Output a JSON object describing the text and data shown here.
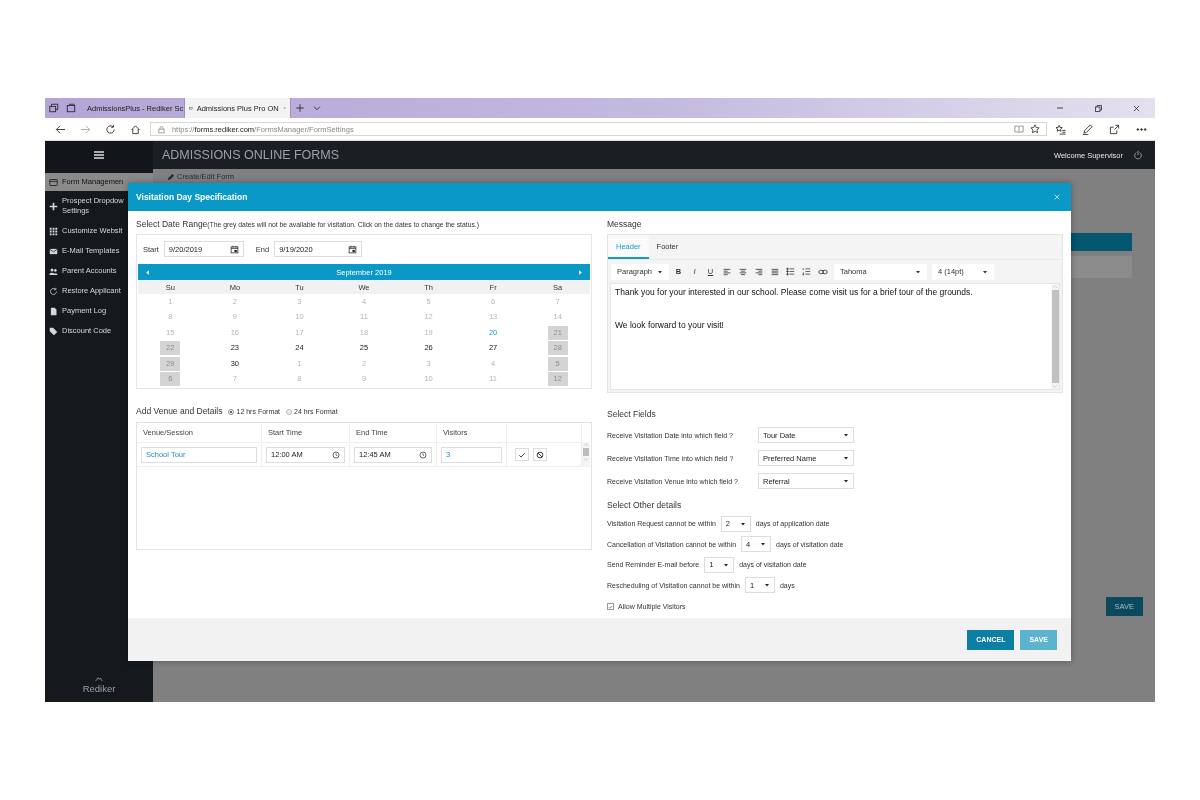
{
  "browser": {
    "tabs": [
      {
        "title": "AdmissionsPlus - Rediker Sc",
        "selected": false
      },
      {
        "title": "Admissions Plus Pro ON",
        "selected": true
      }
    ],
    "address": {
      "scheme": "https://",
      "host": "forms.rediker.com",
      "path": "/FormsManager/FormSettings"
    }
  },
  "app": {
    "title": "ADMISSIONS ONLINE FORMS",
    "welcome": "Welcome Supervisor",
    "sidebar": [
      {
        "label": "Form Managemen",
        "selected": true
      },
      {
        "label": "Prospect Dropdow Settings",
        "selected": false
      },
      {
        "label": "Customize Websit",
        "selected": false
      },
      {
        "label": "E-Mail Templates",
        "selected": false
      },
      {
        "label": "Parent Accounts",
        "selected": false
      },
      {
        "label": "Restore Applicant",
        "selected": false
      },
      {
        "label": "Payment Log",
        "selected": false
      },
      {
        "label": "Discount Code",
        "selected": false
      }
    ],
    "logo": "Rediker",
    "breadcrumb": "Create/Edit Form",
    "save_button": "SAVE"
  },
  "modal": {
    "title": "Visitation Day Specification",
    "date_range": {
      "heading": "Select Date Range",
      "note": "(The grey dates will not be available for visitation. Click on the dates to change the status.)",
      "start_label": "Start",
      "start": "9/20/2019",
      "end_label": "End",
      "end": "9/19/2020"
    },
    "calendar": {
      "month": "September 2019",
      "weekdays": [
        "Su",
        "Mo",
        "Tu",
        "We",
        "Th",
        "Fr",
        "Sa"
      ],
      "weeks": [
        [
          {
            "day": "1",
            "disabled": true,
            "blocked": false,
            "selected": false
          },
          {
            "day": "2",
            "disabled": true,
            "blocked": false,
            "selected": false
          },
          {
            "day": "3",
            "disabled": true,
            "blocked": false,
            "selected": false
          },
          {
            "day": "4",
            "disabled": true,
            "blocked": false,
            "selected": false
          },
          {
            "day": "5",
            "disabled": true,
            "blocked": false,
            "selected": false
          },
          {
            "day": "6",
            "disabled": true,
            "blocked": false,
            "selected": false
          },
          {
            "day": "7",
            "disabled": true,
            "blocked": false,
            "selected": false
          }
        ],
        [
          {
            "day": "8",
            "disabled": true,
            "blocked": false,
            "selected": false
          },
          {
            "day": "9",
            "disabled": true,
            "blocked": false,
            "selected": false
          },
          {
            "day": "10",
            "disabled": true,
            "blocked": false,
            "selected": false
          },
          {
            "day": "11",
            "disabled": true,
            "blocked": false,
            "selected": false
          },
          {
            "day": "12",
            "disabled": true,
            "blocked": false,
            "selected": false
          },
          {
            "day": "13",
            "disabled": true,
            "blocked": false,
            "selected": false
          },
          {
            "day": "14",
            "disabled": true,
            "blocked": false,
            "selected": false
          }
        ],
        [
          {
            "day": "15",
            "disabled": true,
            "blocked": false,
            "selected": false
          },
          {
            "day": "16",
            "disabled": true,
            "blocked": false,
            "selected": false
          },
          {
            "day": "17",
            "disabled": true,
            "blocked": false,
            "selected": false
          },
          {
            "day": "18",
            "disabled": true,
            "blocked": false,
            "selected": false
          },
          {
            "day": "19",
            "disabled": true,
            "blocked": false,
            "selected": false
          },
          {
            "day": "20",
            "disabled": false,
            "blocked": false,
            "selected": true
          },
          {
            "day": "21",
            "disabled": false,
            "blocked": true,
            "selected": false
          }
        ],
        [
          {
            "day": "22",
            "disabled": false,
            "blocked": true,
            "selected": false
          },
          {
            "day": "23",
            "disabled": false,
            "blocked": false,
            "selected": false
          },
          {
            "day": "24",
            "disabled": false,
            "blocked": false,
            "selected": false
          },
          {
            "day": "25",
            "disabled": false,
            "blocked": false,
            "selected": false
          },
          {
            "day": "26",
            "disabled": false,
            "blocked": false,
            "selected": false
          },
          {
            "day": "27",
            "disabled": false,
            "blocked": false,
            "selected": false
          },
          {
            "day": "28",
            "disabled": false,
            "blocked": true,
            "selected": false
          }
        ],
        [
          {
            "day": "29",
            "disabled": false,
            "blocked": true,
            "selected": false
          },
          {
            "day": "30",
            "disabled": false,
            "blocked": false,
            "selected": false
          },
          {
            "day": "1",
            "disabled": true,
            "blocked": false,
            "selected": false
          },
          {
            "day": "2",
            "disabled": true,
            "blocked": false,
            "selected": false
          },
          {
            "day": "3",
            "disabled": true,
            "blocked": false,
            "selected": false
          },
          {
            "day": "4",
            "disabled": true,
            "blocked": false,
            "selected": false
          },
          {
            "day": "5",
            "disabled": false,
            "blocked": true,
            "selected": false
          }
        ],
        [
          {
            "day": "6",
            "disabled": false,
            "blocked": true,
            "selected": false
          },
          {
            "day": "7",
            "disabled": true,
            "blocked": false,
            "selected": false
          },
          {
            "day": "8",
            "disabled": true,
            "blocked": false,
            "selected": false
          },
          {
            "day": "9",
            "disabled": true,
            "blocked": false,
            "selected": false
          },
          {
            "day": "10",
            "disabled": true,
            "blocked": false,
            "selected": false
          },
          {
            "day": "11",
            "disabled": true,
            "blocked": false,
            "selected": false
          },
          {
            "day": "12",
            "disabled": false,
            "blocked": true,
            "selected": false
          }
        ]
      ]
    },
    "venue": {
      "heading": "Add Venue and Details",
      "formats": [
        {
          "label": "12 hrs Format",
          "selected": true
        },
        {
          "label": "24 hrs Format",
          "selected": false
        }
      ],
      "columns": [
        "Venue/Session",
        "Start Time",
        "End Time",
        "Visitors"
      ],
      "rows": [
        {
          "venue": "School Tour",
          "start": "12:00 AM",
          "end": "12:45 AM",
          "visitors": "3"
        }
      ]
    },
    "message": {
      "heading": "Message",
      "tabs": [
        {
          "label": "Header",
          "selected": true
        },
        {
          "label": "Footer",
          "selected": false
        }
      ],
      "block_format": "Paragraph",
      "format_buttons": [
        "B",
        "I",
        "U"
      ],
      "font": "Tahoma",
      "size": "4 (14pt)",
      "paragraphs": [
        "Thank you for your interested in our school. Please come visit us for a brief tour of the grounds.",
        "We look forward to your visit!"
      ]
    },
    "select_fields": {
      "heading": "Select Fields",
      "rows": [
        {
          "label": "Receive Visitation Date into which field ?",
          "value": "Tour Date"
        },
        {
          "label": "Receive Visitation Time into which field ?",
          "value": "Preferred Name"
        },
        {
          "label": "Receive Visitation Venue into which field ?",
          "value": "Referral"
        }
      ]
    },
    "other_details": {
      "heading": "Select Other details",
      "rows": [
        {
          "prefix": "Visitation Request cannot be within",
          "value": "2",
          "suffix": "days of application date"
        },
        {
          "prefix": "Cancellation of Visitation cannot be within",
          "value": "4",
          "suffix": "days of visitation date"
        },
        {
          "prefix": "Send Reminder E-mail before",
          "value": "1",
          "suffix": "days of visitation date"
        },
        {
          "prefix": "Rescheduling of Visitation cannot be within",
          "value": "1",
          "suffix": "days"
        }
      ]
    },
    "allow_multiple": {
      "label": "Allow Multiple Visitors",
      "checked": true
    },
    "cancel_button": "CANCEL",
    "save_button": "SAVE"
  }
}
